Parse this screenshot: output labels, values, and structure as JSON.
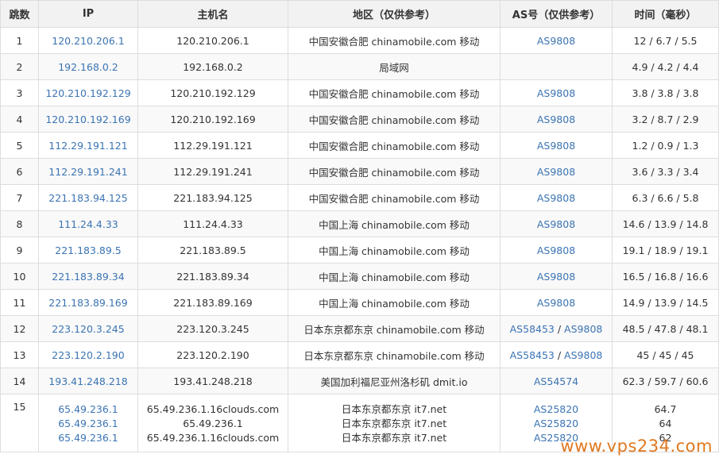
{
  "headers": {
    "hop": "跳数",
    "ip": "IP",
    "host": "主机名",
    "region": "地区（仅供参考）",
    "asn": "AS号（仅供参考）",
    "time": "时间（毫秒）"
  },
  "rows": [
    {
      "hop": "1",
      "ip": "120.210.206.1",
      "host": "120.210.206.1",
      "region": "中国安徽合肥 chinamobile.com 移动",
      "asn": [
        "AS9808"
      ],
      "time": "12 / 6.7 / 5.5"
    },
    {
      "hop": "2",
      "ip": "192.168.0.2",
      "host": "192.168.0.2",
      "region": "局域网",
      "asn": [],
      "time": "4.9 / 4.2 / 4.4"
    },
    {
      "hop": "3",
      "ip": "120.210.192.129",
      "host": "120.210.192.129",
      "region": "中国安徽合肥 chinamobile.com 移动",
      "asn": [
        "AS9808"
      ],
      "time": "3.8 / 3.8 / 3.8"
    },
    {
      "hop": "4",
      "ip": "120.210.192.169",
      "host": "120.210.192.169",
      "region": "中国安徽合肥 chinamobile.com 移动",
      "asn": [
        "AS9808"
      ],
      "time": "3.2 / 8.7 / 2.9"
    },
    {
      "hop": "5",
      "ip": "112.29.191.121",
      "host": "112.29.191.121",
      "region": "中国安徽合肥 chinamobile.com 移动",
      "asn": [
        "AS9808"
      ],
      "time": "1.2 / 0.9 / 1.3"
    },
    {
      "hop": "6",
      "ip": "112.29.191.241",
      "host": "112.29.191.241",
      "region": "中国安徽合肥 chinamobile.com 移动",
      "asn": [
        "AS9808"
      ],
      "time": "3.6 / 3.3 / 3.4"
    },
    {
      "hop": "7",
      "ip": "221.183.94.125",
      "host": "221.183.94.125",
      "region": "中国安徽合肥 chinamobile.com 移动",
      "asn": [
        "AS9808"
      ],
      "time": "6.3 / 6.6 / 5.8"
    },
    {
      "hop": "8",
      "ip": "111.24.4.33",
      "host": "111.24.4.33",
      "region": "中国上海 chinamobile.com 移动",
      "asn": [
        "AS9808"
      ],
      "time": "14.6 / 13.9 / 14.8"
    },
    {
      "hop": "9",
      "ip": "221.183.89.5",
      "host": "221.183.89.5",
      "region": "中国上海 chinamobile.com 移动",
      "asn": [
        "AS9808"
      ],
      "time": "19.1 / 18.9 / 19.1"
    },
    {
      "hop": "10",
      "ip": "221.183.89.34",
      "host": "221.183.89.34",
      "region": "中国上海 chinamobile.com 移动",
      "asn": [
        "AS9808"
      ],
      "time": "16.5 / 16.8 / 16.6"
    },
    {
      "hop": "11",
      "ip": "221.183.89.169",
      "host": "221.183.89.169",
      "region": "中国上海 chinamobile.com 移动",
      "asn": [
        "AS9808"
      ],
      "time": "14.9 / 13.9 / 14.5"
    },
    {
      "hop": "12",
      "ip": "223.120.3.245",
      "host": "223.120.3.245",
      "region": "日本东京都东京 chinamobile.com 移动",
      "asn": [
        "AS58453",
        "AS9808"
      ],
      "time": "48.5 / 47.8 / 48.1"
    },
    {
      "hop": "13",
      "ip": "223.120.2.190",
      "host": "223.120.2.190",
      "region": "日本东京都东京 chinamobile.com 移动",
      "asn": [
        "AS58453",
        "AS9808"
      ],
      "time": "45 / 45 / 45"
    },
    {
      "hop": "14",
      "ip": "193.41.248.218",
      "host": "193.41.248.218",
      "region": "美国加利福尼亚州洛杉矶 dmit.io",
      "asn": [
        "AS54574"
      ],
      "time": "62.3 / 59.7 / 60.6"
    }
  ],
  "multi_row": {
    "hop": "15",
    "ips": [
      "65.49.236.1",
      "65.49.236.1",
      "65.49.236.1"
    ],
    "hosts": [
      "65.49.236.1.16clouds.com",
      "65.49.236.1",
      "65.49.236.1.16clouds.com"
    ],
    "regions": [
      "日本东京都东京 it7.net",
      "日本东京都东京 it7.net",
      "日本东京都东京 it7.net"
    ],
    "asns": [
      "AS25820",
      "AS25820",
      "AS25820"
    ],
    "times": [
      "64.7",
      "64",
      "62"
    ]
  },
  "asn_separator": " / ",
  "watermark": "www.vps234.com",
  "colors": {
    "link": "#3b74b3",
    "header_bg": "#f2f2f2",
    "border": "#dddddd",
    "watermark": "#e0781f"
  }
}
